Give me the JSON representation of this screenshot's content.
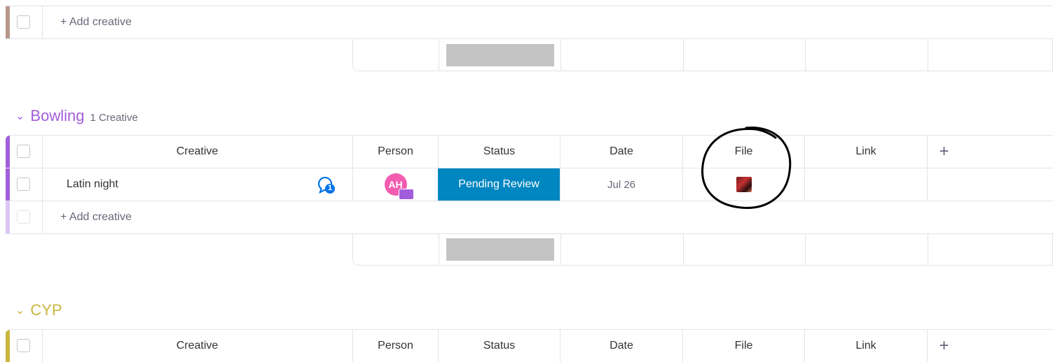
{
  "colors": {
    "group_top_stripe": "#b7978a",
    "bowling": "#a25ddc",
    "bowling_light": "#dcc6f2",
    "cyp": "#cab641",
    "status_pending": "#0086c0",
    "avatar": "#f35cb1"
  },
  "top_group": {
    "add_label": "+ Add creative"
  },
  "groups": [
    {
      "name": "Bowling",
      "count_label": "1 Creative",
      "columns": [
        "Creative",
        "Person",
        "Status",
        "Date",
        "File",
        "Link"
      ],
      "rows": [
        {
          "creative": "Latin night",
          "comment_count": "1",
          "person_initials": "AH",
          "status": "Pending Review",
          "date": "Jul 26",
          "file_icon": "image-thumbnail-icon"
        }
      ],
      "add_label": "+ Add creative"
    },
    {
      "name": "CYP",
      "columns": [
        "Creative",
        "Person",
        "Status",
        "Date",
        "File",
        "Link"
      ]
    }
  ],
  "add_column_symbol": "+",
  "chevron": "⌄"
}
